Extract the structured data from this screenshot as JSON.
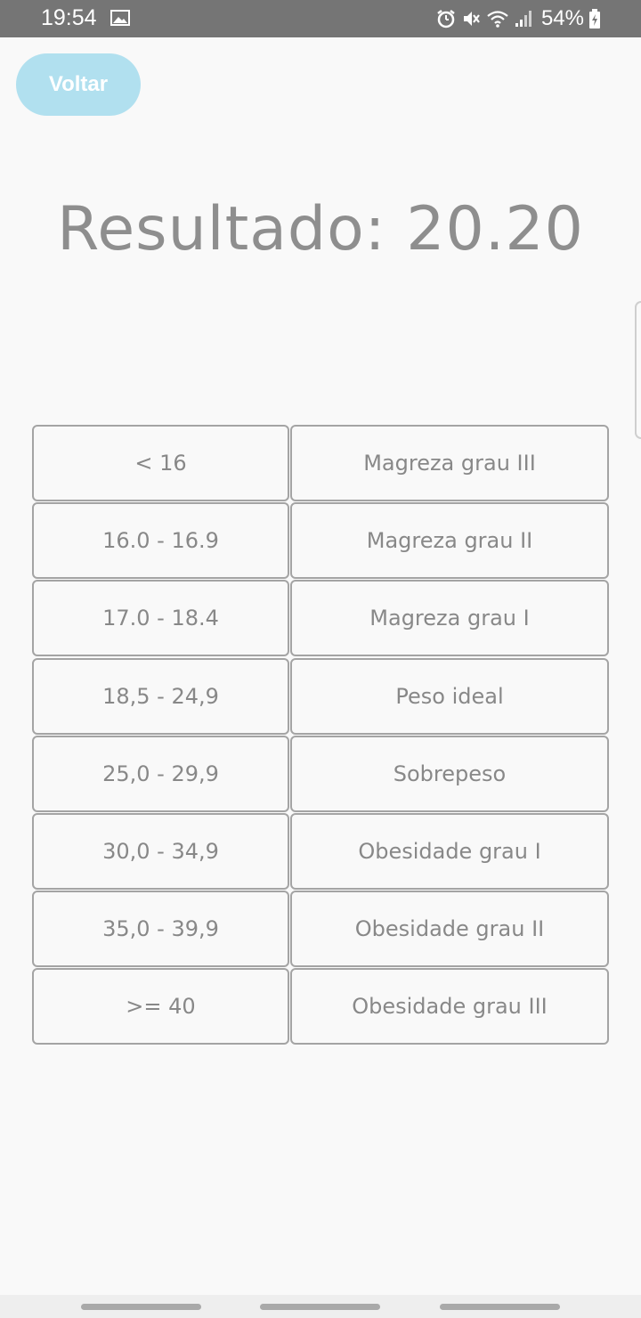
{
  "status_bar": {
    "time": "19:54",
    "battery_percent": "54%",
    "icons": [
      "gallery-icon",
      "alarm-icon",
      "mute-icon",
      "wifi-icon",
      "signal-icon",
      "battery-icon"
    ]
  },
  "header": {
    "back_label": "Voltar"
  },
  "result": {
    "label": "Resultado: 20.20"
  },
  "bmi_table": {
    "rows": [
      {
        "range": "< 16",
        "classification": "Magreza grau III"
      },
      {
        "range": "16.0 - 16.9",
        "classification": "Magreza grau II"
      },
      {
        "range": "17.0 - 18.4",
        "classification": "Magreza grau I"
      },
      {
        "range": "18,5 - 24,9",
        "classification": "Peso ideal"
      },
      {
        "range": "25,0 - 29,9",
        "classification": "Sobrepeso"
      },
      {
        "range": "30,0 - 34,9",
        "classification": "Obesidade grau I"
      },
      {
        "range": "35,0 - 39,9",
        "classification": "Obesidade grau II"
      },
      {
        "range": ">= 40",
        "classification": "Obesidade grau III"
      }
    ]
  },
  "colors": {
    "status_bar_bg": "#757575",
    "button_bg": "#b1e0ef",
    "text_gray": "#8e8e8e",
    "border_gray": "#a4a4a4",
    "background": "#f9f9f9"
  }
}
